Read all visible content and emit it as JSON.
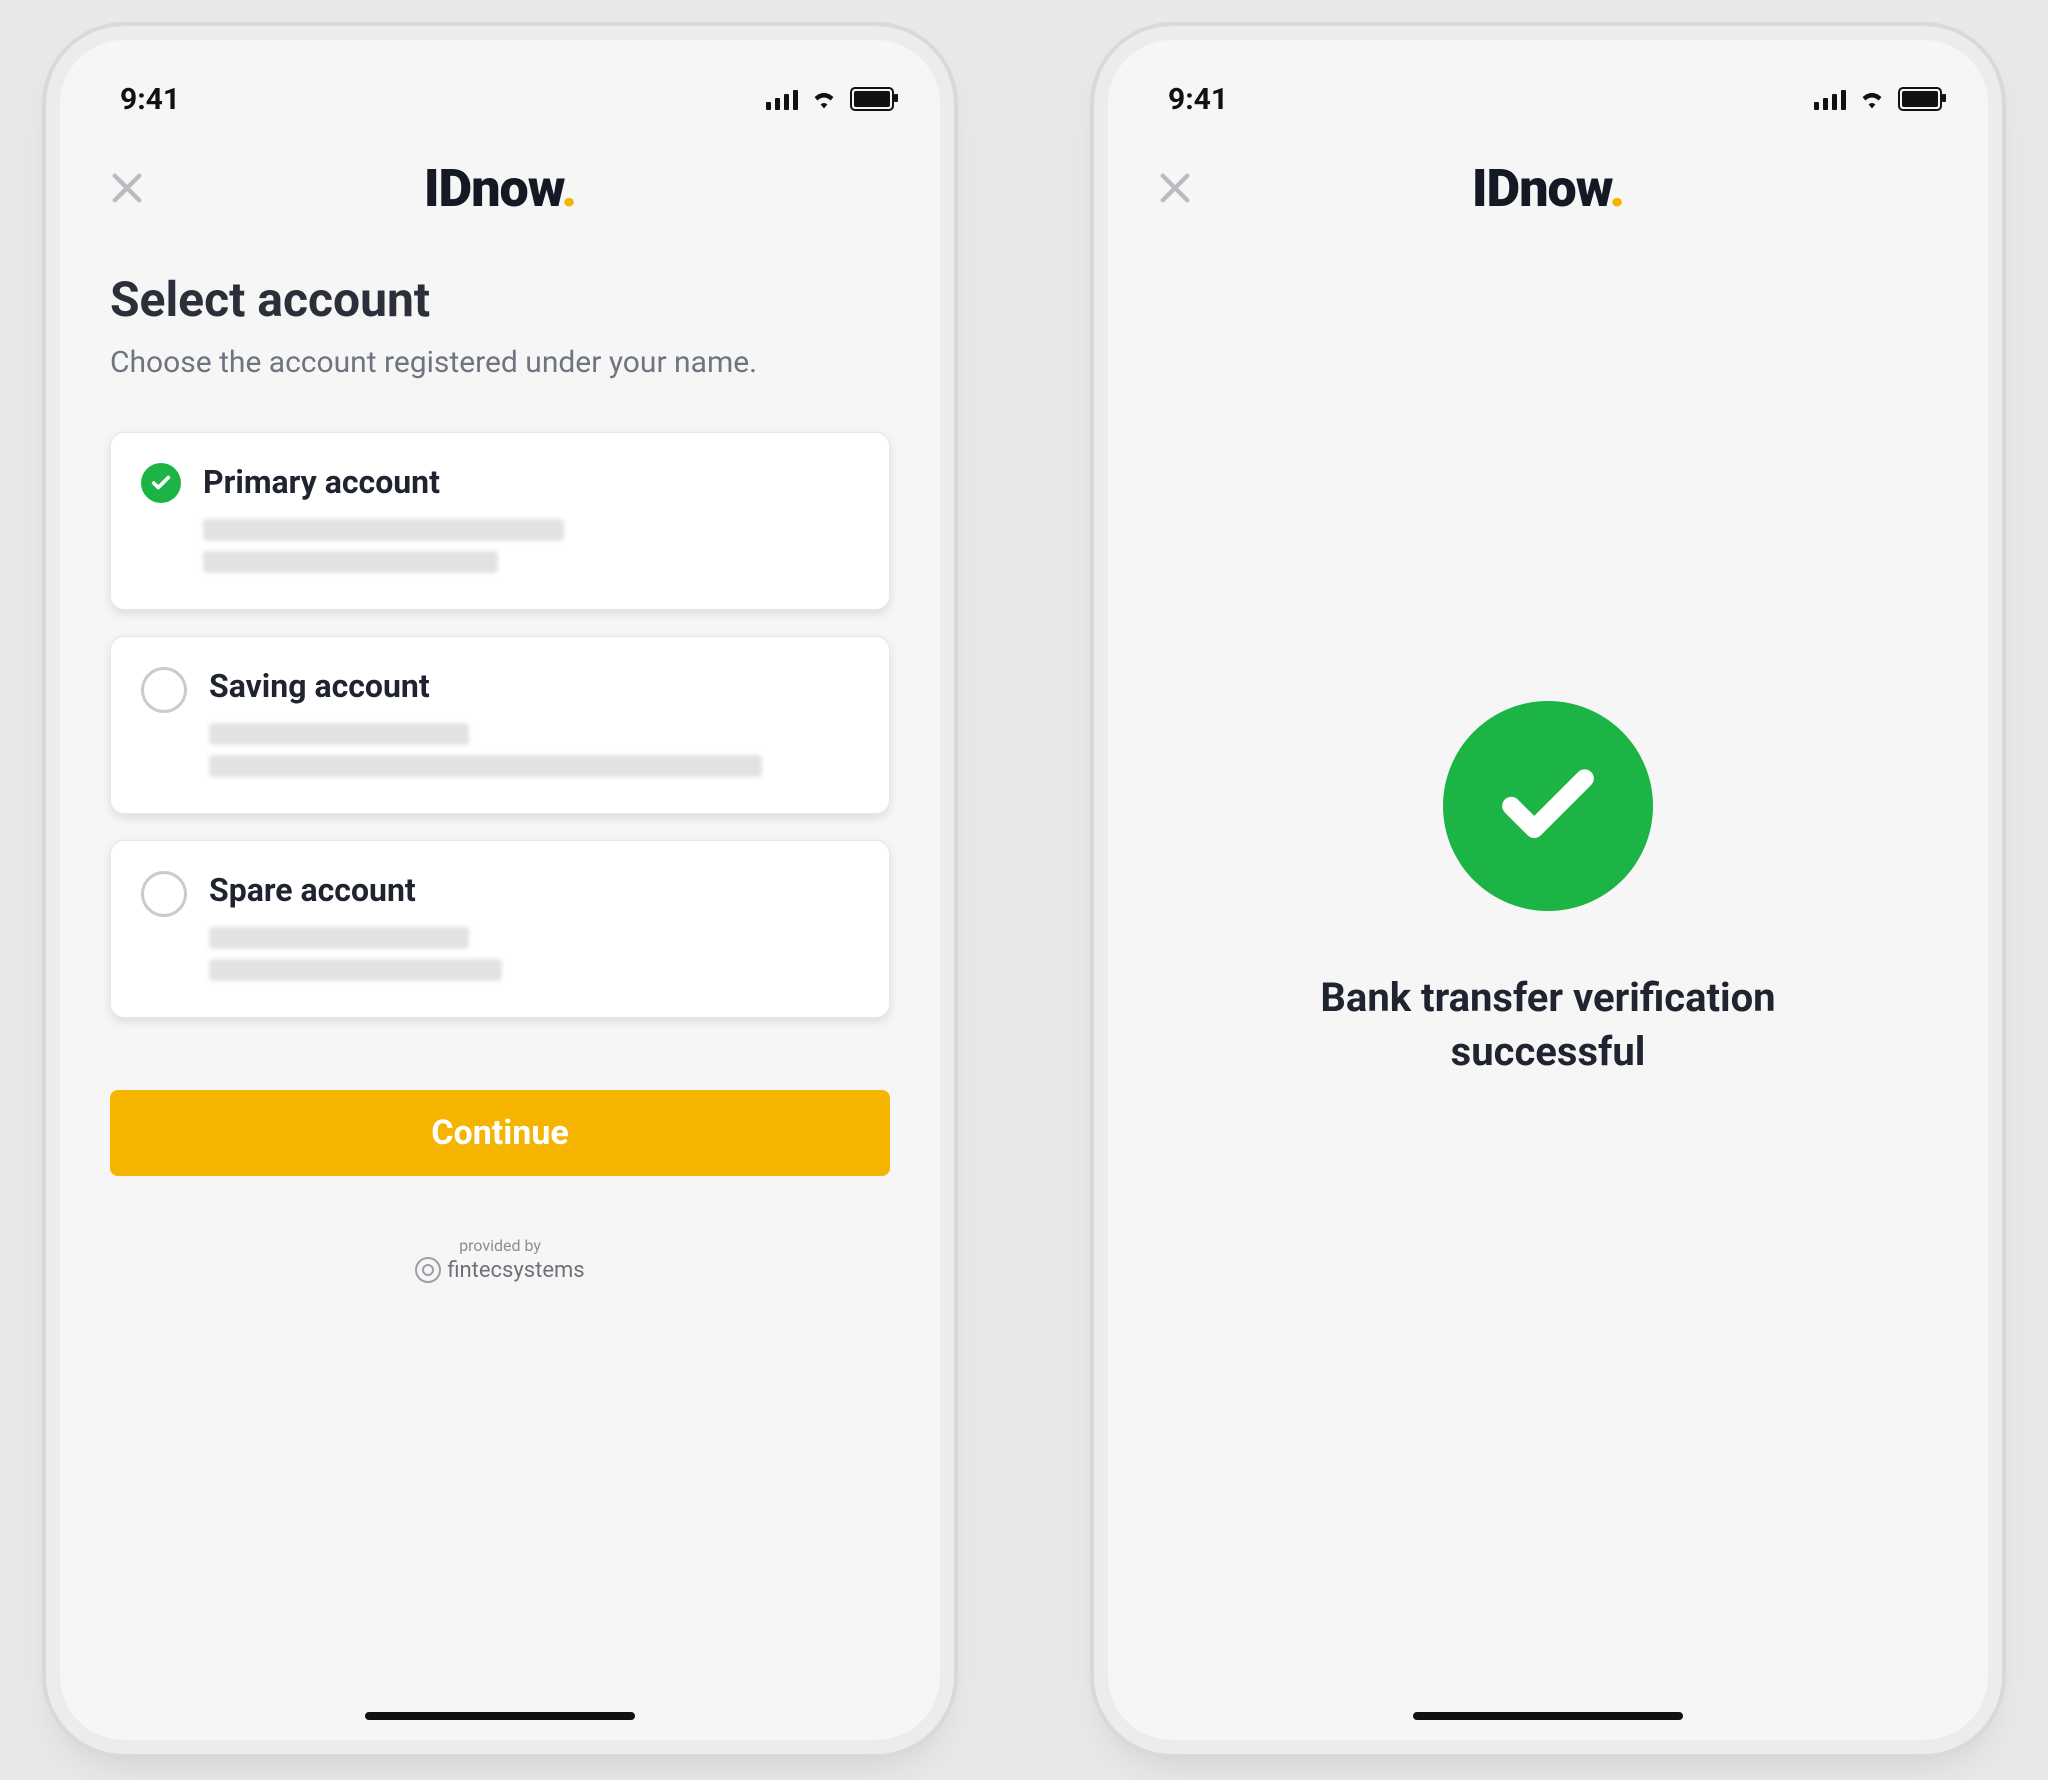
{
  "status": {
    "time": "9:41"
  },
  "brand": {
    "name": "IDnow",
    "dot": "."
  },
  "screen1": {
    "title": "Select account",
    "subtitle": "Choose the account registered under your name.",
    "accounts": [
      {
        "label": "Primary account",
        "selected": true
      },
      {
        "label": "Saving account",
        "selected": false
      },
      {
        "label": "Spare account",
        "selected": false
      }
    ],
    "cta": "Continue",
    "provided": {
      "label": "provided by",
      "vendor": "fintecsystems"
    }
  },
  "screen2": {
    "success_text": "Bank transfer verification successful"
  },
  "colors": {
    "accent": "#f4b400",
    "success": "#1db446"
  }
}
